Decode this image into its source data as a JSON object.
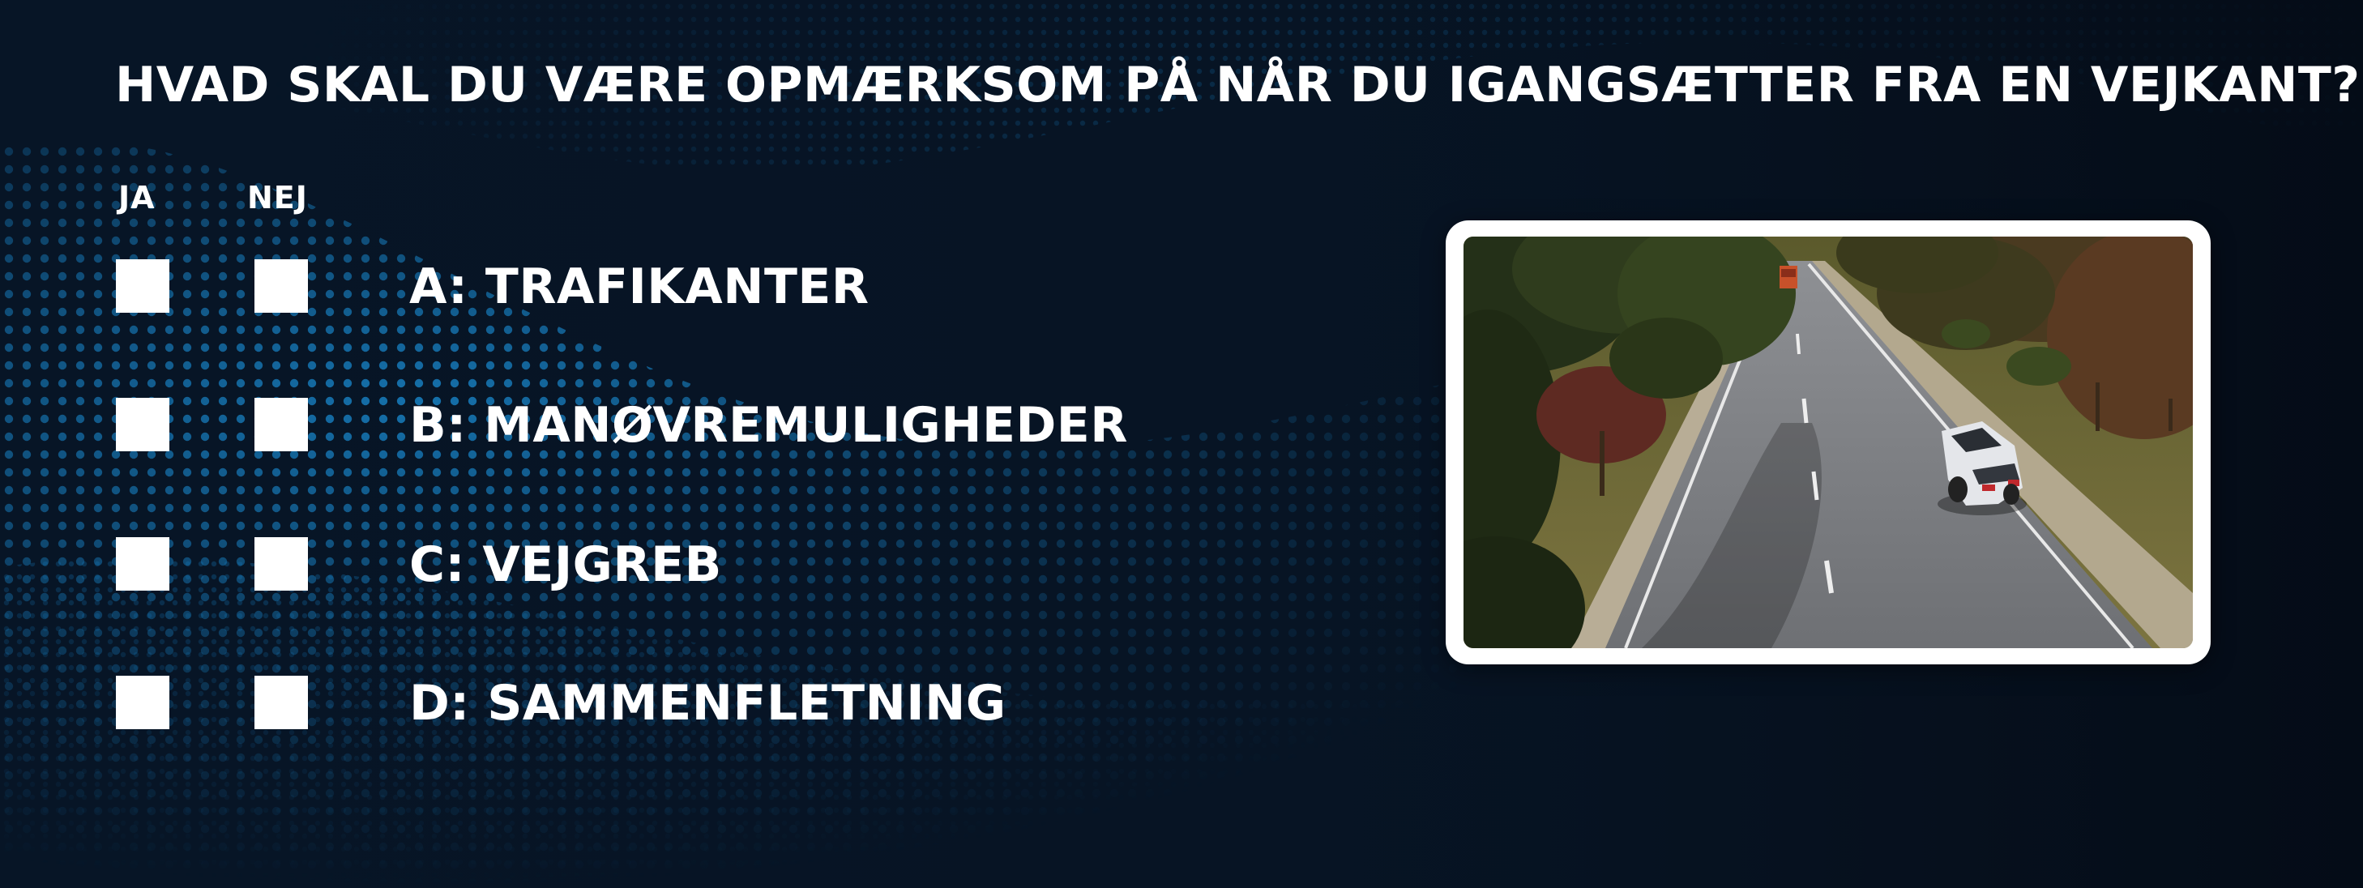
{
  "question": "HVAD SKAL DU VÆRE OPMÆRKSOM PÅ NÅR DU IGANGSÆTTER FRA EN VEJKANT?",
  "columns": {
    "yes": "JA",
    "no": "NEJ"
  },
  "answers": [
    {
      "label": "A: TRAFIKANTER"
    },
    {
      "label": "B: MANØVREMULIGHEDER"
    },
    {
      "label": "C: VEJGREB"
    },
    {
      "label": "D: SAMMENFLETNING"
    }
  ],
  "colors": {
    "background": "#06101c",
    "dot_accent": "#1a8fd8",
    "text": "#ffffff",
    "checkbox": "#ffffff",
    "frame": "#ffffff"
  },
  "illustration": {
    "icon": "road-scene-image"
  }
}
